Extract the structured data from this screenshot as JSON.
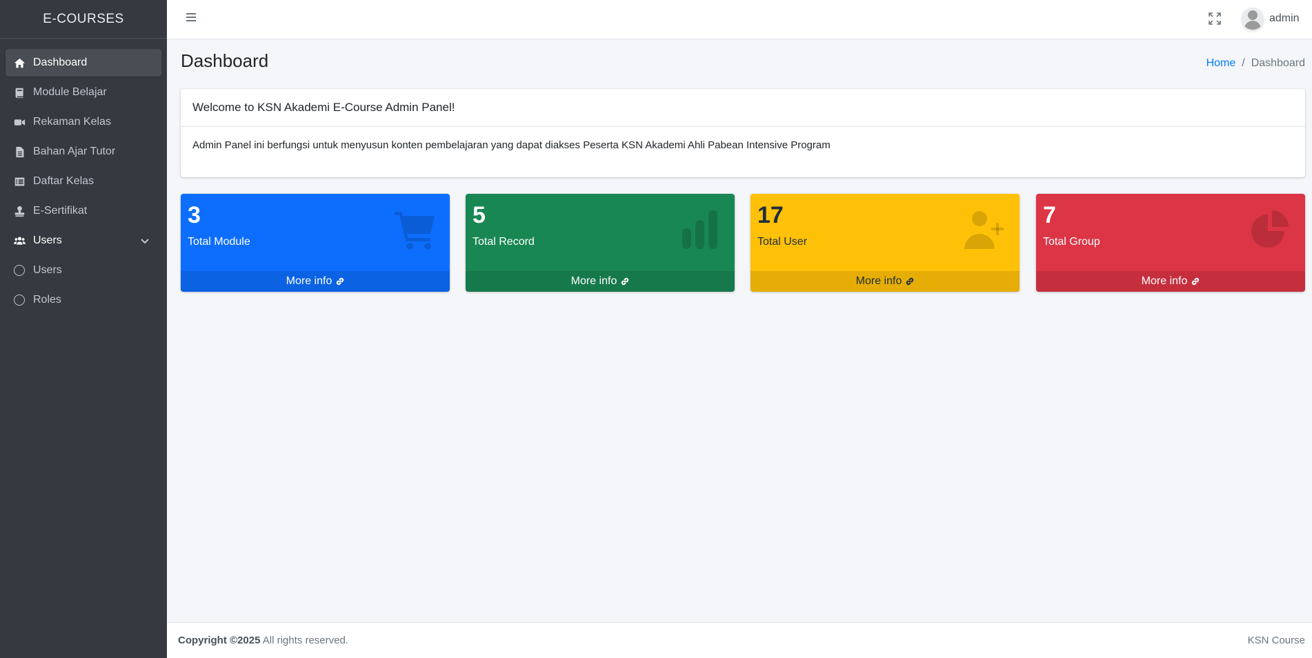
{
  "sidebar": {
    "brand": "E-COURSES",
    "items": [
      {
        "label": "Dashboard",
        "icon": "home-icon"
      },
      {
        "label": "Module Belajar",
        "icon": "book-icon"
      },
      {
        "label": "Rekaman Kelas",
        "icon": "video-icon"
      },
      {
        "label": "Bahan Ajar Tutor",
        "icon": "file-icon"
      },
      {
        "label": "Daftar Kelas",
        "icon": "list-icon"
      },
      {
        "label": "E-Sertifikat",
        "icon": "stamp-icon"
      },
      {
        "label": "Users",
        "icon": "users-icon"
      },
      {
        "label": "Users",
        "icon": "circle-icon"
      },
      {
        "label": "Roles",
        "icon": "circle-icon"
      }
    ]
  },
  "topbar": {
    "username": "admin"
  },
  "header": {
    "title": "Dashboard",
    "breadcrumb": {
      "home": "Home",
      "separator": "/",
      "current": "Dashboard"
    }
  },
  "welcome": {
    "title": "Welcome to KSN Akademi E-Course Admin Panel!",
    "body": "Admin Panel ini berfungsi untuk menyusun konten pembelajaran yang dapat diakses Peserta KSN Akademi Ahli Pabean Intensive Program"
  },
  "stats": [
    {
      "value": "3",
      "label": "Total Module",
      "more": "More info",
      "color": "#0d6efd",
      "icon": "cart-icon"
    },
    {
      "value": "5",
      "label": "Total Record",
      "more": "More info",
      "color": "#198754",
      "icon": "bar-chart-icon"
    },
    {
      "value": "17",
      "label": "Total User",
      "more": "More info",
      "color": "#ffc107",
      "icon": "user-plus-icon"
    },
    {
      "value": "7",
      "label": "Total Group",
      "more": "More info",
      "color": "#dc3545",
      "icon": "pie-chart-icon"
    }
  ],
  "footer": {
    "copyright": "Copyright ©2025",
    "rights": "All rights reserved.",
    "brand": "KSN Course"
  }
}
